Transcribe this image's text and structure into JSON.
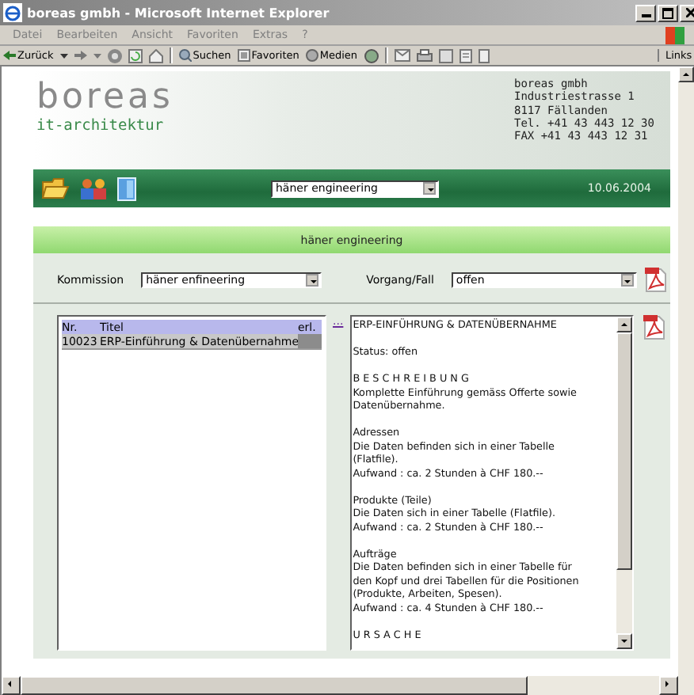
{
  "window": {
    "title": "boreas gmbh - Microsoft Internet Explorer"
  },
  "menu": [
    "Datei",
    "Bearbeiten",
    "Ansicht",
    "Favoriten",
    "Extras",
    "?"
  ],
  "toolbar": {
    "back": "Zurück",
    "search": "Suchen",
    "favorites": "Favoriten",
    "media": "Medien",
    "links": "Links"
  },
  "header": {
    "logo": "boreas",
    "tagline": "it-architektur",
    "address": [
      "boreas gmbh",
      "Industriestrasse 1",
      "8117 Fällanden",
      "Tel. +41 43 443 12 30",
      "FAX +41 43 443 12 31"
    ]
  },
  "nav": {
    "company_select": "häner engineering",
    "date": "10.06.2004"
  },
  "panel": {
    "title": "häner engineering",
    "filters": [
      {
        "label": "Kommission",
        "value": "häner enfineering"
      },
      {
        "label": "Vorgang/Fall",
        "value": "offen"
      }
    ],
    "list": {
      "columns": [
        "Nr.",
        "Titel",
        "erl."
      ],
      "rows": [
        {
          "nr": "10023",
          "title": "ERP-Einführung & Datenübernahme",
          "selected": true
        }
      ],
      "more": "..."
    },
    "detail": [
      [
        "ERP-EINFÜHRUNG & DATENÜBERNAHME"
      ],
      [
        "Status: offen"
      ],
      [
        "B E S C H R E I B U N G",
        "Komplette Einführung gemäss Offerte sowie",
        "Datenübernahme."
      ],
      [
        "Adressen",
        "Die Daten befinden sich in einer Tabelle",
        "(Flatfile).",
        "Aufwand : ca. 2 Stunden à CHF 180.--"
      ],
      [
        "Produkte (Teile)",
        "Die Daten sich in einer Tabelle (Flatfile).",
        "Aufwand : ca. 2 Stunden à CHF 180.--"
      ],
      [
        "Aufträge",
        "Die Daten befinden sich in einer Tabelle für",
        "den Kopf und drei Tabellen für die Positionen",
        "(Produkte, Arbeiten, Spesen).",
        "Aufwand : ca. 4 Stunden à CHF 180.--"
      ],
      [
        "U R S A C H E"
      ]
    ]
  }
}
